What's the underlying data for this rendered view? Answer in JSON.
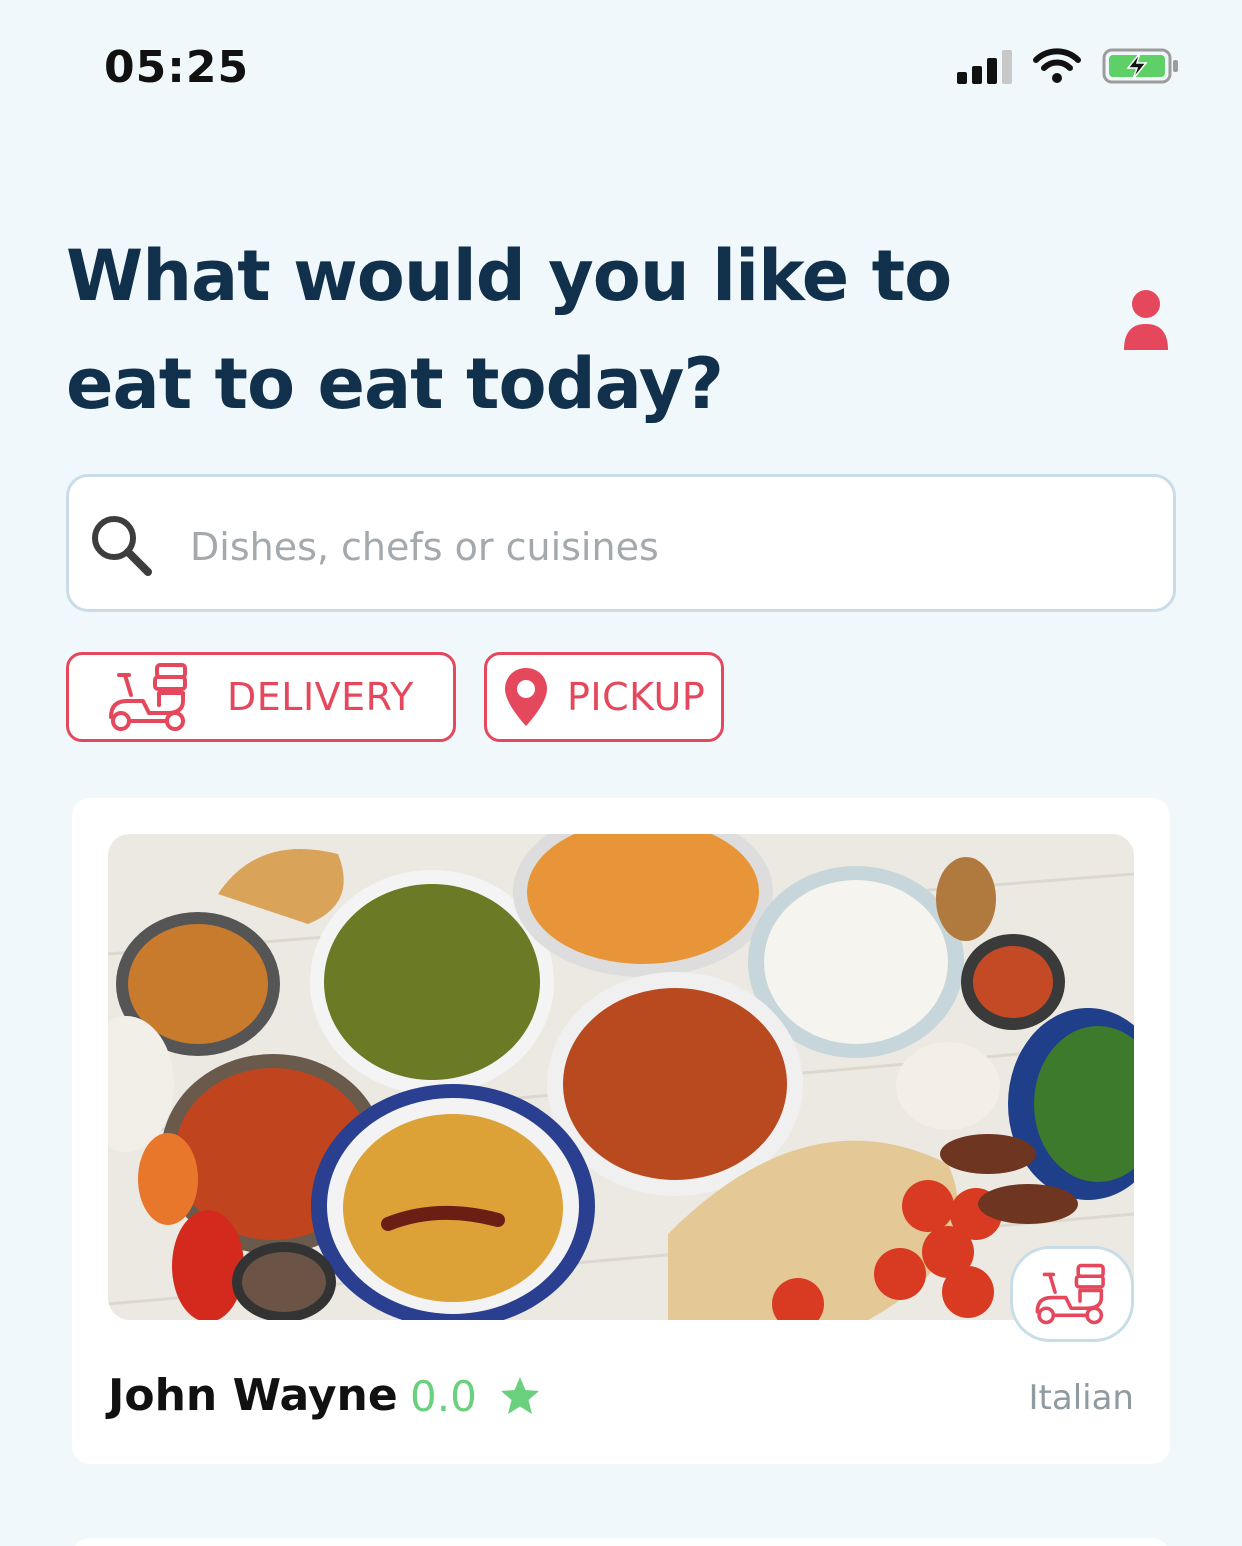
{
  "status_bar": {
    "time": "05:25"
  },
  "header": {
    "title": "What would you like to eat to eat today?"
  },
  "search": {
    "placeholder": "Dishes, chefs or cuisines",
    "value": ""
  },
  "filters": {
    "delivery_label": "DELIVERY",
    "pickup_label": "PICKUP"
  },
  "listings": [
    {
      "chef": "John Wayne",
      "rating": "0.0",
      "cuisine": "Italian"
    }
  ],
  "colors": {
    "accent": "#e5485c",
    "heading": "#11304b",
    "rating": "#6bd07d",
    "background": "#f1f8fc"
  },
  "icons": {
    "profile": "person-icon",
    "search": "search-icon",
    "delivery": "scooter-icon",
    "pickup": "location-pin-icon",
    "rating": "star-icon"
  }
}
